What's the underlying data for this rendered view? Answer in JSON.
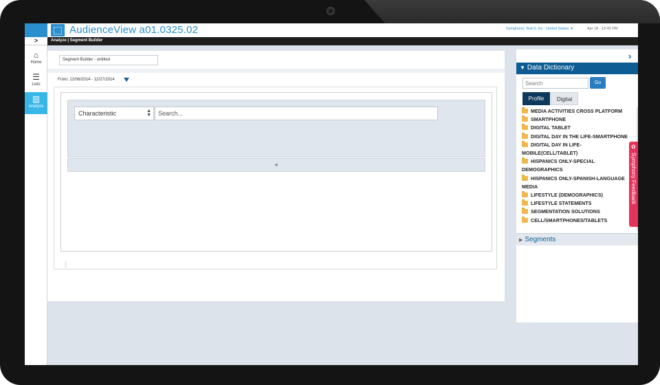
{
  "colors": {
    "brand_blue": "#2a8fcc",
    "nav_active": "#38b6e8",
    "dictionary_header": "#0d5c93",
    "feedback": "#e4335b",
    "folder": "#f0b84a"
  },
  "header": {
    "app_title": "AudienceView a01.0325.02",
    "account": "Symphonic Test 0, Inc : United States",
    "datetime": "Apr 18 - 12:42 PM",
    "breadcrumb": "Analyze | Segment Builder",
    "expand_icon": "chevron-right-icon"
  },
  "nav": {
    "items": [
      {
        "label": "Home",
        "icon": "home-icon",
        "glyph": "⌂"
      },
      {
        "label": "Lists",
        "icon": "list-icon",
        "glyph": "☰"
      },
      {
        "label": "Analyze",
        "icon": "bar-chart-icon",
        "glyph": "▥"
      }
    ]
  },
  "builder": {
    "title_value": "Segment Builder - untitled",
    "date_range": "From: 12/06/2014 - 12/27/2014",
    "characteristic_label": "Characteristic",
    "search_placeholder": "Search...",
    "add_label": "+"
  },
  "dictionary": {
    "title": "Data Dictionary",
    "search_placeholder": "Search",
    "go_label": "Go",
    "tabs": [
      "Profile",
      "Digital"
    ],
    "categories": [
      "MEDIA ACTIVITIES CROSS PLATFORM",
      "SMARTPHONE",
      "DIGITAL TABLET",
      "DIGITAL DAY IN THE LIFE-SMARTPHONE",
      "DIGITAL DAY IN LIFE-MOBILE(CELL/TABLET)",
      "HISPANICS ONLY-SPECIAL DEMOGRAPHICS",
      "HISPANICS ONLY-SPANISH-LANGUAGE MEDIA",
      "LIFESTYLE (DEMOGRAPHICS)",
      "LIFESTYLE STATEMENTS",
      "SEGMENTATION SOLUTIONS",
      "CELL/SMARTPHONES/TABLETS"
    ],
    "segments_label": "Segments"
  },
  "feedback": {
    "label": "Symphony Feedback"
  }
}
